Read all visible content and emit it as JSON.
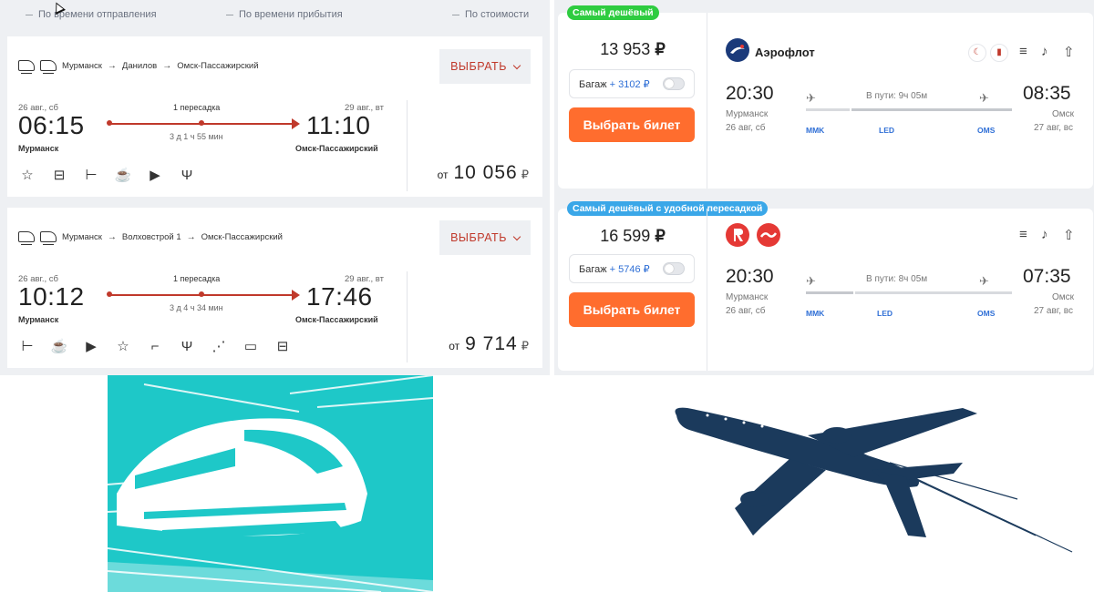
{
  "sortbar": {
    "items": [
      "По времени отправления",
      "По времени прибытия",
      "По стоимости"
    ]
  },
  "trains": [
    {
      "route": [
        "Мурманск",
        "Данилов",
        "Омск-Пассажирский"
      ],
      "select_label": "ВЫБРАТЬ",
      "dep_date": "26 авг., сб",
      "dep_time": "06:15",
      "dep_city": "Мурманск",
      "arr_date": "29 авг., вт",
      "arr_time": "11:10",
      "arr_city": "Омск-Пассажирский",
      "transfers": "1 пересадка",
      "duration": "3 д 1 ч 55 мин",
      "amenities": [
        "star-icon",
        "luggage-icon",
        "bed-icon",
        "coffee-icon",
        "play-icon",
        "fork-knife-icon"
      ],
      "price_prefix": "от",
      "price": "10 056",
      "currency": "₽"
    },
    {
      "route": [
        "Мурманск",
        "Волховстрой 1",
        "Омск-Пассажирский"
      ],
      "select_label": "ВЫБРАТЬ",
      "dep_date": "26 авг., сб",
      "dep_time": "10:12",
      "dep_city": "Мурманск",
      "arr_date": "29 авг., вт",
      "arr_time": "17:46",
      "arr_city": "Омск-Пассажирский",
      "transfers": "1 пересадка",
      "duration": "3 д 4 ч 34 мин",
      "amenities": [
        "bed-icon",
        "coffee-icon",
        "play-icon",
        "star-icon",
        "stairs-icon",
        "fork-knife-icon",
        "shower-icon",
        "train-icon",
        "luggage-icon"
      ],
      "price_prefix": "от",
      "price": "9 714",
      "currency": "₽"
    }
  ],
  "flights": [
    {
      "badge": "Самый дешёвый",
      "badge_color": "#2ecc40",
      "price": "13 953",
      "currency": "₽",
      "baggage_label": "Багаж",
      "baggage_price": "+ 3102 ₽",
      "buy_label": "Выбрать билет",
      "airline": "Аэрофлот",
      "dep_time": "20:30",
      "dep_city": "Мурманск",
      "dep_date": "26 авг, сб",
      "arr_time": "08:35",
      "arr_city": "Омск",
      "arr_date": "27 авг, вс",
      "duration": "В пути: 9ч 05м",
      "iata": [
        "MMK",
        "LED",
        "OMS"
      ]
    },
    {
      "badge": "Самый дешёвый с удобной пересадкой",
      "badge_color": "#3aa7e8",
      "price": "16 599",
      "currency": "₽",
      "baggage_label": "Багаж",
      "baggage_price": "+ 5746 ₽",
      "buy_label": "Выбрать билет",
      "dep_time": "20:30",
      "dep_city": "Мурманск",
      "dep_date": "26 авг, сб",
      "arr_time": "07:35",
      "arr_city": "Омск",
      "arr_date": "27 авг, вс",
      "duration": "В пути: 8ч 05м",
      "iata": [
        "MMK",
        "LED",
        "OMS"
      ]
    }
  ],
  "colors": {
    "accent_red": "#c0392b",
    "buy_orange": "#ff6d2e",
    "illustration_teal": "#1ec8c8",
    "illustration_navy": "#1b3a5c"
  }
}
